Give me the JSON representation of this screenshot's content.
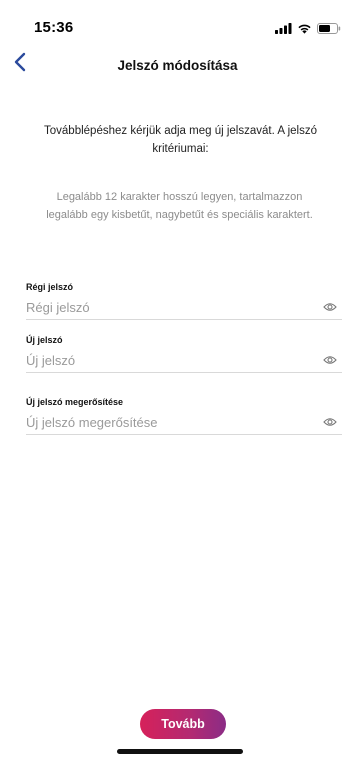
{
  "status_bar": {
    "time": "15:36",
    "icons": [
      "cellular-signal-icon",
      "wifi-icon",
      "battery-icon"
    ]
  },
  "nav": {
    "back_icon": "chevron-left-icon",
    "title": "Jelszó módosítása"
  },
  "intro": {
    "text": "Továbblépéshez kérjük adja meg új jelszavát. A jelszó kritériumai:"
  },
  "criteria": {
    "text": "Legalább 12 karakter hosszú legyen, tartalmazzon legalább egy kisbetűt, nagybetűt és speciális karaktert."
  },
  "form": {
    "old_password": {
      "label": "Régi jelszó",
      "placeholder": "Régi jelszó",
      "value": ""
    },
    "new_password": {
      "label": "Új jelszó",
      "placeholder": "Új jelszó",
      "value": ""
    },
    "confirm_password": {
      "label": "Új jelszó megerősítése",
      "placeholder": "Új jelszó megerősítése",
      "value": ""
    },
    "toggle_icon": "eye-icon"
  },
  "actions": {
    "next_label": "Tovább"
  },
  "colors": {
    "accent": "#2b4a9c",
    "button_gradient_start": "#d6215a",
    "button_gradient_end": "#8b2c86",
    "muted_text": "#8c8c8c",
    "divider": "#d9d9d9"
  }
}
